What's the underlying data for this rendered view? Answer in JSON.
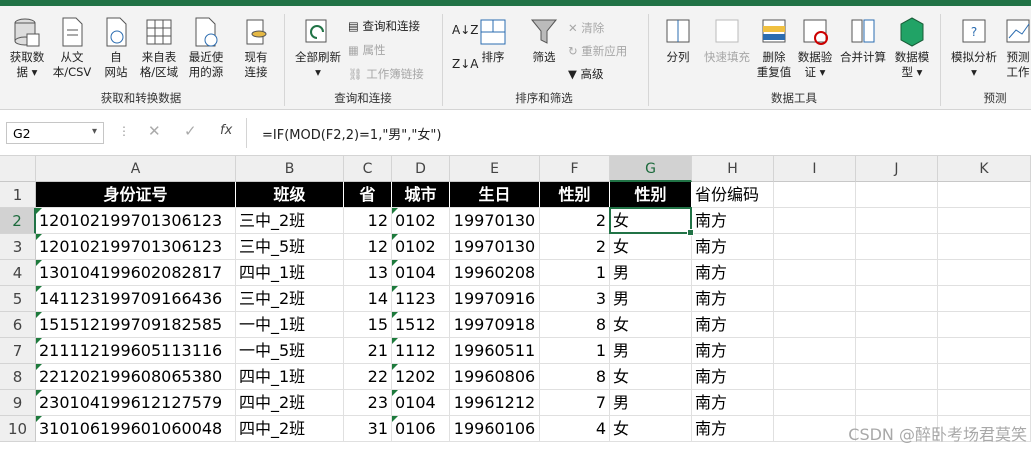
{
  "ribbon": {
    "groups": {
      "get_transform": "获取和转换数据",
      "query_conn": "查询和连接",
      "sort_filter": "排序和筛选",
      "data_tools": "数据工具",
      "forecast": "预测"
    },
    "buttons": {
      "get_data": [
        "获取数",
        "据 ▾"
      ],
      "from_text": [
        "从文",
        "本/CSV"
      ],
      "from_web": [
        "自",
        "网站"
      ],
      "from_table": [
        "来自表",
        "格/区域"
      ],
      "recent_sources": [
        "最近使",
        "用的源"
      ],
      "existing_conn": [
        "现有",
        "连接"
      ],
      "refresh_all": [
        "全部刷新",
        "▾"
      ],
      "queries_conn": "查询和连接",
      "properties": "属性",
      "edit_links": "工作簿链接",
      "sort": "排序",
      "filter": "筛选",
      "clear": "清除",
      "reapply": "重新应用",
      "advanced": "高级",
      "split": "分列",
      "flash_fill": "快速填充",
      "remove_dup": [
        "删除",
        "重复值"
      ],
      "data_validation": [
        "数据验",
        "证 ▾"
      ],
      "consolidate": "合并计算",
      "data_model": [
        "数据模",
        "型 ▾"
      ],
      "what_if": [
        "模拟分析",
        "▾"
      ],
      "forecast_sheet": [
        "预测",
        "工作"
      ]
    }
  },
  "formula_bar": {
    "name_box": "G2",
    "fx": "fx",
    "formula": "=IF(MOD(F2,2)=1,\"男\",\"女\")"
  },
  "columns": [
    "A",
    "B",
    "C",
    "D",
    "E",
    "F",
    "G",
    "H",
    "I",
    "J",
    "K"
  ],
  "rows": [
    "1",
    "2",
    "3",
    "4",
    "5",
    "6",
    "7",
    "8",
    "9",
    "10"
  ],
  "headers": {
    "A": "身份证号",
    "B": "班级",
    "C": "省",
    "D": "城市",
    "E": "生日",
    "F": "性别",
    "G": "性别",
    "H": "省份编码"
  },
  "data": [
    {
      "A": "120102199701306123",
      "B": "三中_2班",
      "C": "12",
      "D": "0102",
      "E": "19970130",
      "F": "2",
      "G": "女",
      "H": "南方"
    },
    {
      "A": "120102199701306123",
      "B": "三中_5班",
      "C": "12",
      "D": "0102",
      "E": "19970130",
      "F": "2",
      "G": "女",
      "H": "南方"
    },
    {
      "A": "130104199602082817",
      "B": "四中_1班",
      "C": "13",
      "D": "0104",
      "E": "19960208",
      "F": "1",
      "G": "男",
      "H": "南方"
    },
    {
      "A": "141123199709166436",
      "B": "三中_2班",
      "C": "14",
      "D": "1123",
      "E": "19970916",
      "F": "3",
      "G": "男",
      "H": "南方"
    },
    {
      "A": "151512199709182585",
      "B": "一中_1班",
      "C": "15",
      "D": "1512",
      "E": "19970918",
      "F": "8",
      "G": "女",
      "H": "南方"
    },
    {
      "A": "211112199605113116",
      "B": "一中_5班",
      "C": "21",
      "D": "1112",
      "E": "19960511",
      "F": "1",
      "G": "男",
      "H": "南方"
    },
    {
      "A": "221202199608065380",
      "B": "四中_1班",
      "C": "22",
      "D": "1202",
      "E": "19960806",
      "F": "8",
      "G": "女",
      "H": "南方"
    },
    {
      "A": "230104199612127579",
      "B": "四中_2班",
      "C": "23",
      "D": "0104",
      "E": "19961212",
      "F": "7",
      "G": "男",
      "H": "南方"
    },
    {
      "A": "310106199601060048",
      "B": "四中_2班",
      "C": "31",
      "D": "0106",
      "E": "19960106",
      "F": "4",
      "G": "女",
      "H": "南方"
    }
  ],
  "watermark": "CSDN @醉卧考场君莫笑",
  "colors": {
    "accent": "#217346",
    "header_fill": "#000000",
    "header_text": "#ffffff"
  }
}
